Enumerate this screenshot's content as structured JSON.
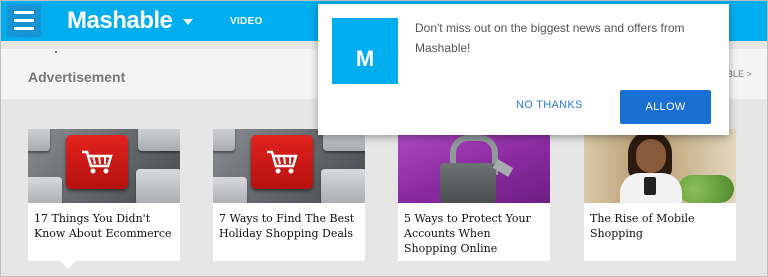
{
  "header": {
    "brand": "Mashable",
    "nav_video": "VIDEO"
  },
  "ad_section": {
    "label": "Advertisement",
    "more_link": "BLE >"
  },
  "cards": [
    {
      "title": "17 Things You Didn't Know About Ecommerce",
      "image": "keyboard-cart-key"
    },
    {
      "title": "7 Ways to Find The Best Holiday Shopping Deals",
      "image": "keyboard-cart-key"
    },
    {
      "title": "5 Ways to Protect Your Accounts When Shopping Online",
      "image": "purple-padlock"
    },
    {
      "title": "The Rise of Mobile Shopping",
      "image": "woman-with-phone"
    }
  ],
  "popup": {
    "logo_letter": "M",
    "message": "Don't miss out on the biggest news and offers from Mashable!",
    "no_thanks_label": "NO THANKS",
    "allow_label": "ALLOW"
  },
  "colors": {
    "brand_blue": "#00aeef",
    "allow_blue": "#1a6fd3",
    "link_blue": "#2b7bd9"
  }
}
